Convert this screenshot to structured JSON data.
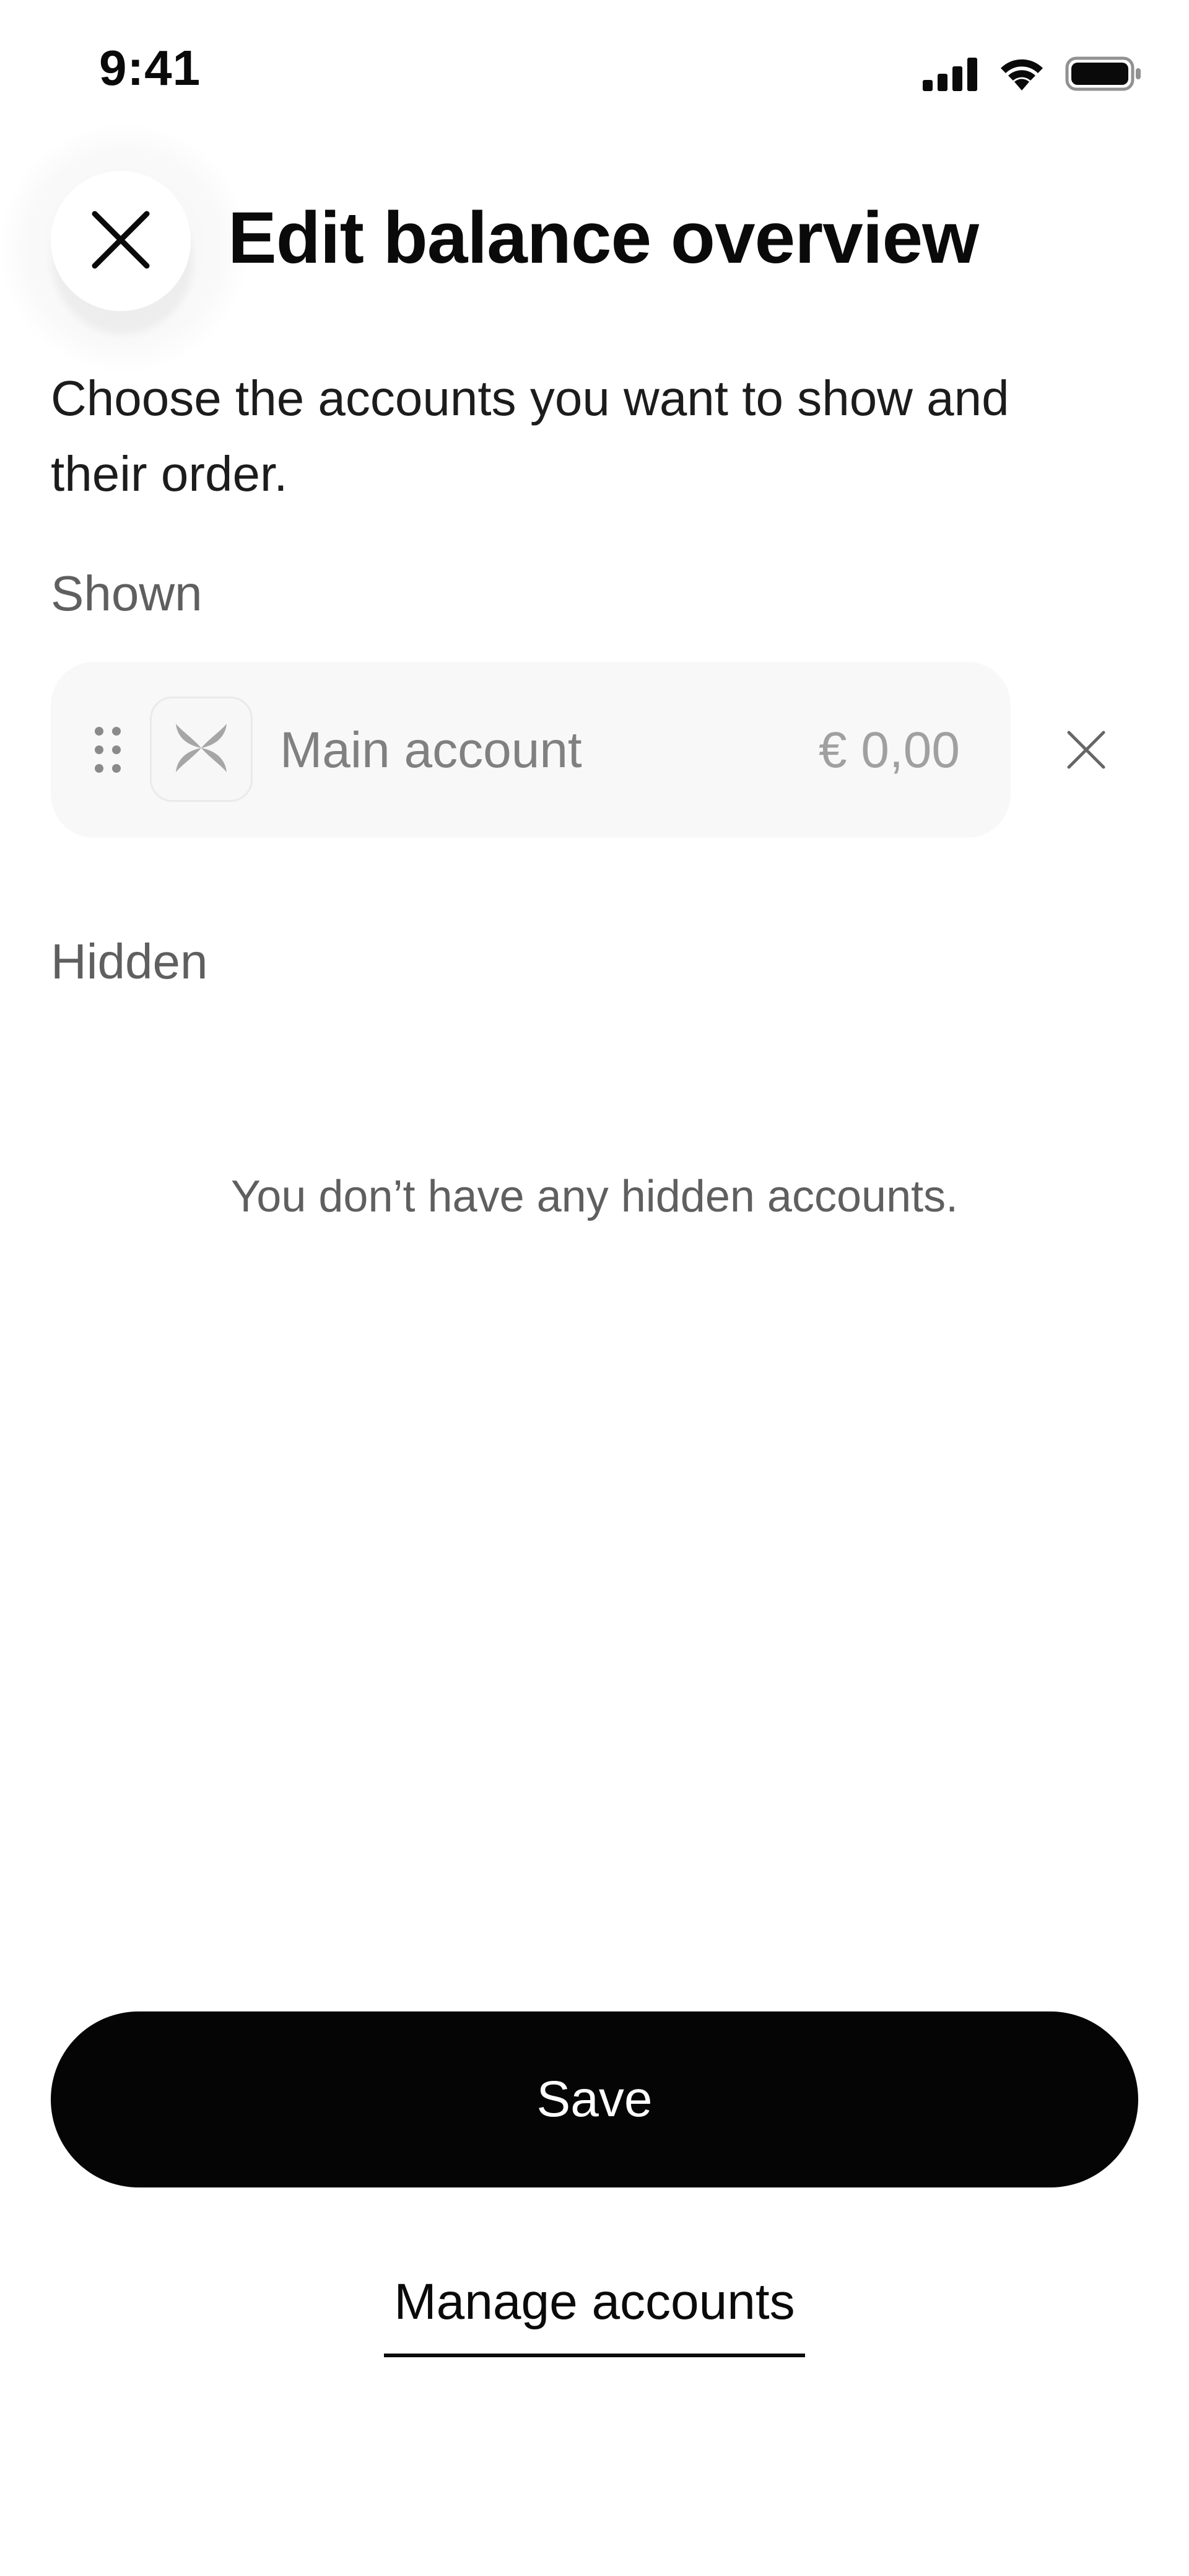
{
  "status_bar": {
    "time": "9:41",
    "icons": [
      "cellular-signal-icon",
      "wifi-icon",
      "battery-icon"
    ]
  },
  "header": {
    "close_icon": "close-icon",
    "title": "Edit balance overview"
  },
  "subtitle": "Choose the accounts you want to show and their order.",
  "shown_section": {
    "label": "Shown",
    "accounts": [
      {
        "name": "Main account",
        "balance": "€ 0,00",
        "icon": "brand-logo-icon",
        "drag_icon": "drag-handle-icon",
        "remove_icon": "remove-icon"
      }
    ]
  },
  "hidden_section": {
    "label": "Hidden",
    "empty_message": "You don’t have any hidden accounts."
  },
  "actions": {
    "save_label": "Save",
    "manage_label": "Manage accounts"
  },
  "colors": {
    "primary_button": "#050505",
    "card_background": "#f8f8f8",
    "muted_text": "#5f5f5f"
  }
}
